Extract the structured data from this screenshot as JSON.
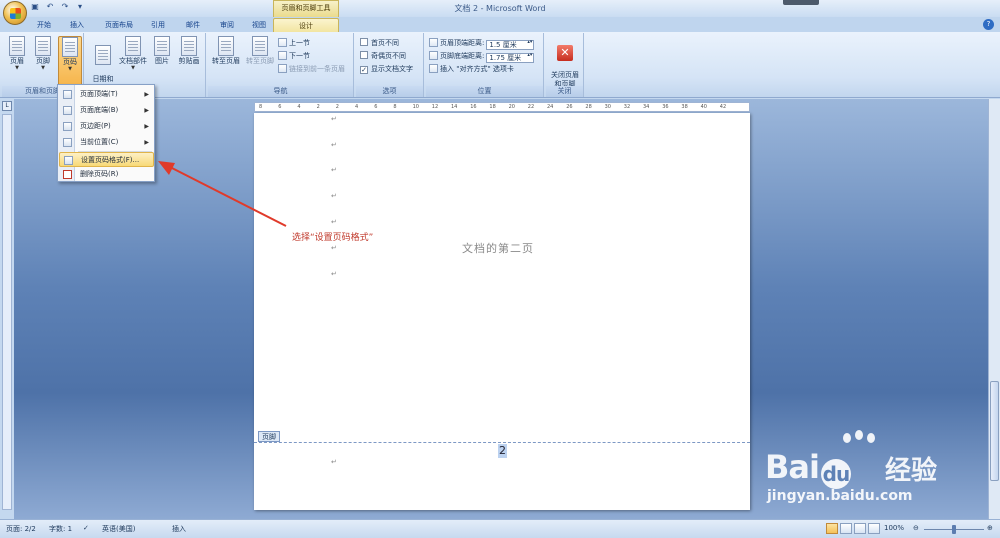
{
  "window": {
    "title": "文档 2 - Microsoft Word",
    "context_tab_title": "页眉和页脚工具"
  },
  "tabs": [
    "开始",
    "插入",
    "页面布局",
    "引用",
    "邮件",
    "审阅",
    "视图",
    "设计"
  ],
  "ribbon": {
    "groups": {
      "header_footer": {
        "label": "页眉和页脚",
        "buttons": [
          "页眉",
          "页脚",
          "页码"
        ]
      },
      "insert": {
        "buttons": [
          "日期和\n时间",
          "文档部件",
          "图片",
          "剪贴画"
        ]
      },
      "navigation": {
        "label": "导航",
        "buttons": [
          "转至页眉",
          "转至页脚"
        ],
        "small": [
          "上一节",
          "下一节",
          "链接到前一条页眉"
        ]
      },
      "options": {
        "label": "选项",
        "items": [
          "首页不同",
          "奇偶页不同",
          "显示文档文字"
        ],
        "checked": [
          false,
          false,
          true
        ]
      },
      "position": {
        "label": "位置",
        "header_label": "页眉顶端距离:",
        "header_value": "1.5 厘米",
        "footer_label": "页脚底端距离:",
        "footer_value": "1.75 厘米",
        "align_tab": "插入 \"对齐方式\" 选项卡"
      },
      "close": {
        "label": "关闭",
        "button": "关闭页眉\n和页脚"
      }
    }
  },
  "dropdown": {
    "items": [
      "页面顶端(T)",
      "页面底端(B)",
      "页边距(P)",
      "当前位置(C)",
      "设置页码格式(F)...",
      "删除页码(R)"
    ],
    "submenu": [
      true,
      true,
      true,
      true,
      false,
      false
    ],
    "highlighted_index": 4
  },
  "document": {
    "ruler_marks": [
      "8",
      "6",
      "4",
      "2",
      "2",
      "4",
      "6",
      "8",
      "10",
      "12",
      "14",
      "16",
      "18",
      "20",
      "22",
      "24",
      "26",
      "28",
      "30",
      "32",
      "34",
      "36",
      "38",
      "40",
      "42"
    ],
    "para_mark": "↵",
    "page_text": "文档的第二页",
    "footer_tag": "页脚",
    "page_number": "2"
  },
  "annotation": {
    "text": "选择“设置页码格式”"
  },
  "watermark": {
    "brand": "Bai",
    "brand2": "du",
    "jingyan": "经验",
    "url": "jingyan.baidu.com"
  },
  "status": {
    "page": "页面: 2/2",
    "words": "字数: 1",
    "language": "英语(美国)",
    "mode": "插入",
    "zoom": "100%"
  },
  "colors": {
    "annotation": "#c0392b",
    "ribbon_highlight": "#f6b54c"
  }
}
